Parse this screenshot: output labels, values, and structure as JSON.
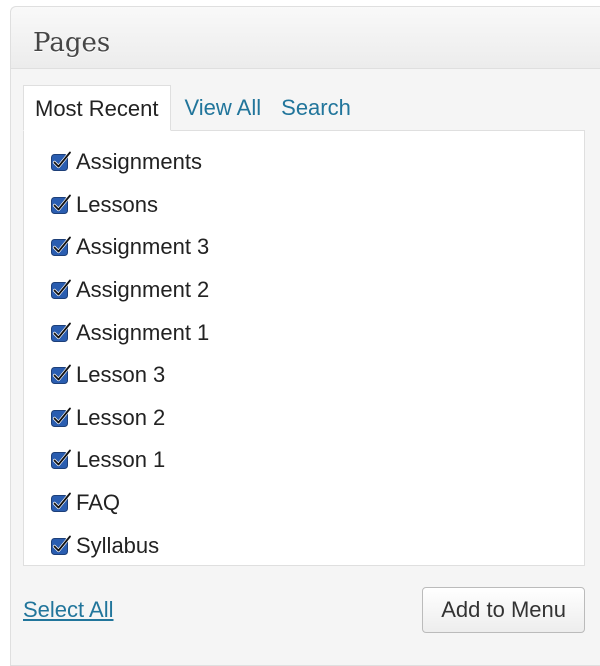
{
  "panel": {
    "title": "Pages"
  },
  "tabs": [
    {
      "label": "Most Recent",
      "active": true
    },
    {
      "label": "View All",
      "active": false
    },
    {
      "label": "Search",
      "active": false
    }
  ],
  "items": [
    {
      "label": "Assignments",
      "checked": true
    },
    {
      "label": "Lessons",
      "checked": true
    },
    {
      "label": "Assignment 3",
      "checked": true
    },
    {
      "label": "Assignment 2",
      "checked": true
    },
    {
      "label": "Assignment 1",
      "checked": true
    },
    {
      "label": "Lesson 3",
      "checked": true
    },
    {
      "label": "Lesson 2",
      "checked": true
    },
    {
      "label": "Lesson 1",
      "checked": true
    },
    {
      "label": "FAQ",
      "checked": true
    },
    {
      "label": "Syllabus",
      "checked": true
    }
  ],
  "footer": {
    "select_all_label": "Select All",
    "add_button_label": "Add to Menu"
  },
  "colors": {
    "link": "#21759b",
    "checkbox_fill": "#2a5db0",
    "panel_bg": "#f5f5f5",
    "border": "#dfdfdf"
  },
  "icons": {
    "checkbox": "checkbox-checked-icon"
  }
}
